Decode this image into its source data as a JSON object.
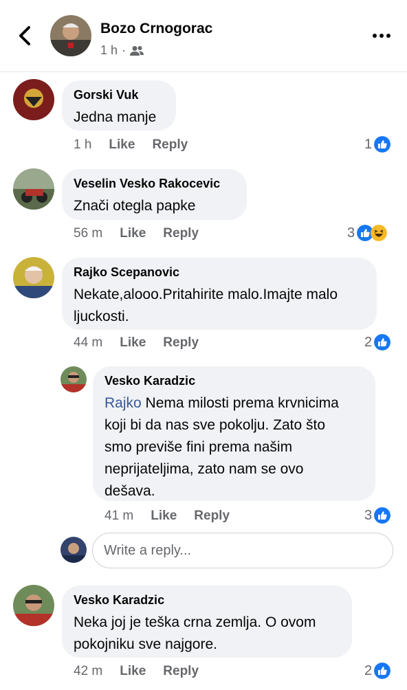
{
  "header": {
    "name": "Bozo Crnogorac",
    "time": "1 h",
    "separator": "·",
    "back_icon": "chevron-left-icon",
    "audience_icon": "friends-icon",
    "more_icon": "more-icon"
  },
  "comments": [
    {
      "author": "Gorski Vuk",
      "text": "Jedna manje",
      "time": "1 h",
      "like": "Like",
      "reply": "Reply",
      "reaction_count": "1",
      "reactions": [
        "like"
      ]
    },
    {
      "author": "Veselin Vesko Rakocevic",
      "text": "Znači otegla papke",
      "time": "56 m",
      "like": "Like",
      "reply": "Reply",
      "reaction_count": "3",
      "reactions": [
        "like",
        "haha"
      ]
    },
    {
      "author": "Rajko Scepanovic",
      "text_line1": "Nekate,alooo.Pritahirite malo.Imajte malo",
      "text_line2": "ljuckosti.",
      "time": "44 m",
      "like": "Like",
      "reply": "Reply",
      "reaction_count": "2",
      "reactions": [
        "like"
      ]
    },
    {
      "author": "Vesko Karadzic",
      "mention": "Rajko",
      "text_line1": " Nema milosti prema krvnicima",
      "text_line2": "koji bi da nas sve pokolju. Zato što",
      "text_line3": "smo previše fini prema našim",
      "text_line4": "neprijateljima, zato nam se ovo",
      "text_line5": "dešava.",
      "time": "41 m",
      "like": "Like",
      "reply": "Reply",
      "reaction_count": "3",
      "reactions": [
        "like"
      ]
    },
    {
      "author": "Vesko Karadzic",
      "text_line1": "Neka joj je teška crna zemlja. O ovom",
      "text_line2": "pokojniku sve najgore.",
      "time": "42 m",
      "like": "Like",
      "reply": "Reply",
      "reaction_count": "2",
      "reactions": [
        "like"
      ]
    }
  ],
  "reply_box": {
    "placeholder": "Write a reply..."
  },
  "colors": {
    "like_blue": "#1877f2",
    "haha_yellow": "#f7b928",
    "secondary_text": "#65676b",
    "bubble_bg": "#f0f2f5"
  }
}
